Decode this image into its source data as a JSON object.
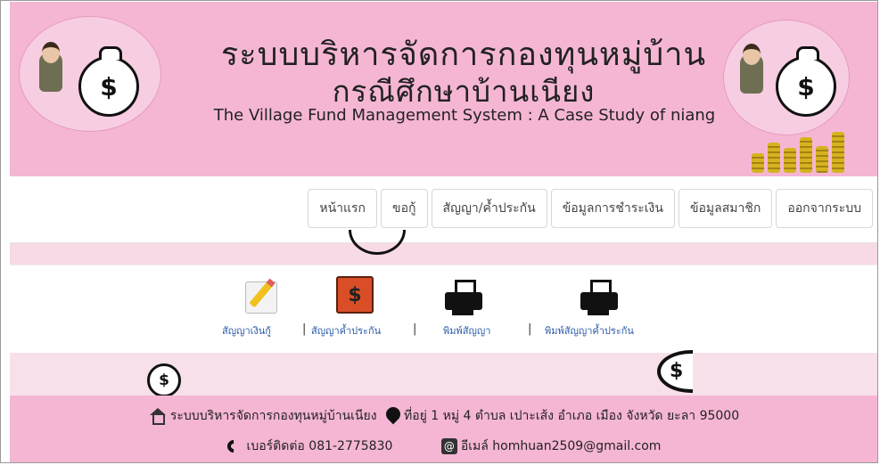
{
  "header": {
    "title_th_line1": "ระบบบริหารจัดการกองทุนหมู่บ้าน",
    "title_th_line2": "กรณีศึกษาบ้านเนียง",
    "title_en": "The Village Fund Management System : A Case Study of niang",
    "logo_symbol": "$",
    "colors": {
      "header_bg": "#f5b6d4",
      "circle_bg": "#f7cde1"
    }
  },
  "nav": {
    "items": [
      {
        "label": "หน้าแรก"
      },
      {
        "label": "ขอกู้"
      },
      {
        "label": "สัญญา/ค้ำประกัน"
      },
      {
        "label": "ข้อมูลการชำระเงิน"
      },
      {
        "label": "ข้อมูลสมาชิก"
      },
      {
        "label": "ออกจากระบบ"
      }
    ]
  },
  "menu": {
    "items": [
      {
        "label": "สัญญาเงินกู้",
        "icon": "edit-icon"
      },
      {
        "label": "สัญญาค้ำประกัน",
        "icon": "contract-icon"
      },
      {
        "label": "พิมพ์สัญญา",
        "icon": "printer-icon"
      },
      {
        "label": "พิมพ์สัญญาค้ำประกัน",
        "icon": "printer-icon"
      }
    ],
    "separator": "|",
    "icon_symbol": "$"
  },
  "footer": {
    "site_name": "ระบบบริหารจัดการกองทุนหมู่บ้านเนียง",
    "address": "ที่อยู่ 1 หมู่ 4 ตำบล เปาะเส้ง อำเภอ เมือง จังหวัด ยะลา 95000",
    "phone": "เบอร์ติดต่อ 081-2775830",
    "email": "อีเมล์ homhuan2509@gmail.com",
    "at_symbol": "@"
  }
}
